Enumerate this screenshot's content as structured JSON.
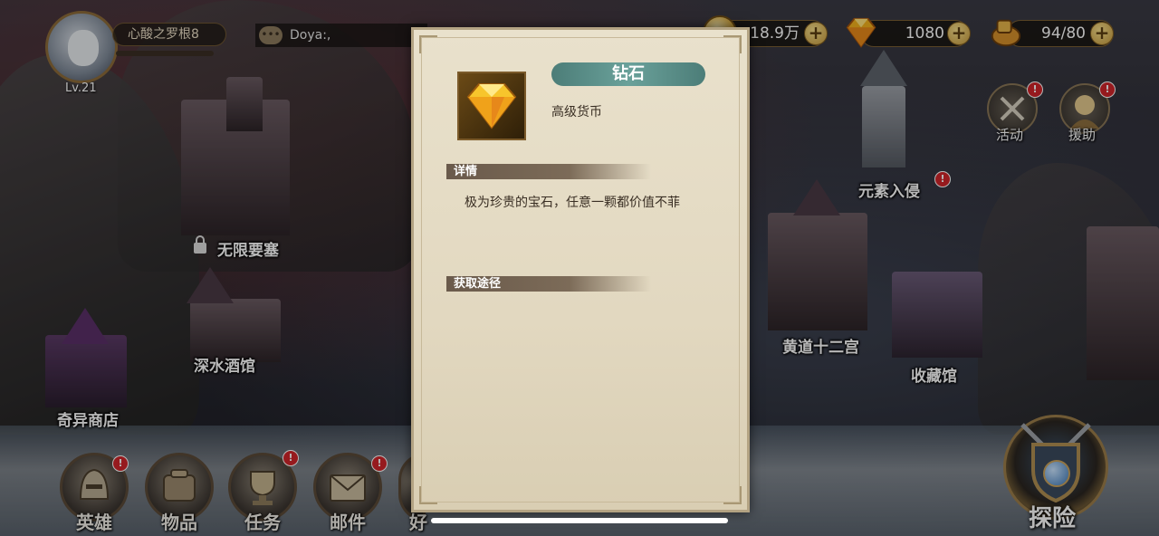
{
  "player": {
    "name": "心酸之罗根8",
    "level": "Lv.21"
  },
  "chat": {
    "preview": "Doya:,"
  },
  "currency": {
    "gold": "18.9万",
    "diamond": "1080",
    "stamina": "94/80"
  },
  "map_locations": {
    "infinite_fortress": "无限要塞",
    "deepwater_tavern": "深水酒馆",
    "strange_shop": "奇异商店",
    "element_invasion": "元素入侵",
    "zodiac": "黄道十二宫",
    "collection": "收藏馆"
  },
  "side_buttons": {
    "events": "活动",
    "support": "援助"
  },
  "nav": {
    "heroes": "英雄",
    "items": "物品",
    "quests": "任务",
    "mail": "邮件",
    "friends": "好",
    "explore": "探险"
  },
  "badge": "!",
  "popup": {
    "item_name": "钻石",
    "item_type": "高级货币",
    "details_heading": "详情",
    "details_text": "极为珍贵的宝石，任意一颗都价值不菲",
    "source_heading": "获取途径"
  }
}
